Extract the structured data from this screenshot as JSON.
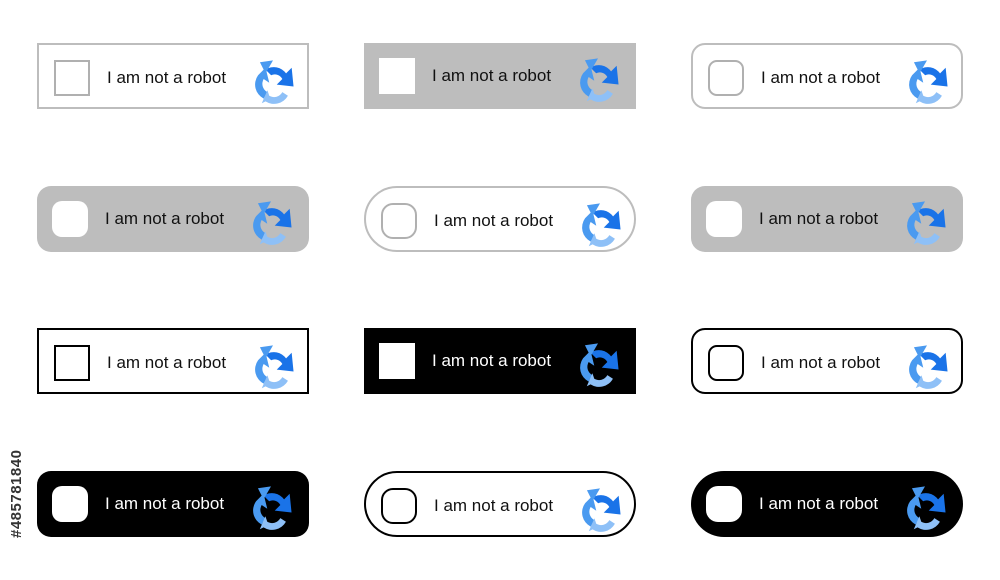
{
  "widgets": [
    {
      "label": "I am not a robot",
      "style": "outline-sq"
    },
    {
      "label": "I am not a robot",
      "style": "grey-sq"
    },
    {
      "label": "I am not a robot",
      "style": "outline-round"
    },
    {
      "label": "I am not a robot",
      "style": "grey-rounded"
    },
    {
      "label": "I am not a robot",
      "style": "outline-pill"
    },
    {
      "label": "I am not a robot",
      "style": "grey-rounded"
    },
    {
      "label": "I am not a robot",
      "style": "black-sq-outline"
    },
    {
      "label": "I am not a robot",
      "style": "black-sq"
    },
    {
      "label": "I am not a robot",
      "style": "black-round-outline"
    },
    {
      "label": "I am not a robot",
      "style": "black-rounded"
    },
    {
      "label": "I am not a robot",
      "style": "black-pill-outline"
    },
    {
      "label": "I am not a robot",
      "style": "black-pill"
    }
  ],
  "logo_icon": "recaptcha-arrows-icon",
  "colors": {
    "arrow_dark": "#1a73e8",
    "arrow_mid": "#4a9af0",
    "arrow_light": "#8ec0f7",
    "grey": "#bdbdbd",
    "black": "#000000"
  },
  "side_id": "#485781840"
}
